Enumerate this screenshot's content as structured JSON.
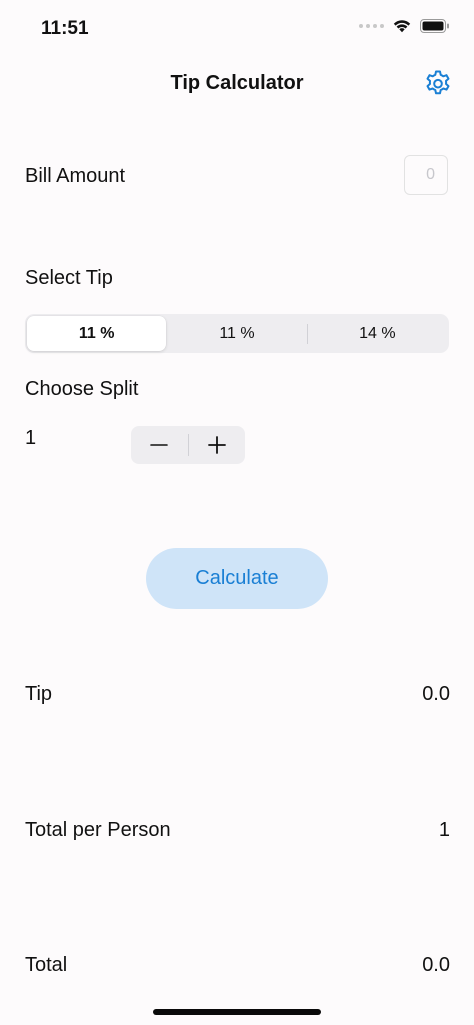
{
  "status_bar": {
    "time": "11:51"
  },
  "nav": {
    "title": "Tip Calculator",
    "settings_icon": "gear-icon"
  },
  "bill": {
    "label": "Bill Amount",
    "input_value": "",
    "placeholder": "0"
  },
  "tip_select": {
    "label": "Select Tip",
    "options": [
      "11 %",
      "11 %",
      "14 %"
    ],
    "selected_index": 0
  },
  "split": {
    "label": "Choose Split",
    "value": "1",
    "decrement_label": "−",
    "increment_label": "+"
  },
  "calculate_button": {
    "label": "Calculate"
  },
  "results": {
    "tip_label": "Tip",
    "tip_value": "0.0",
    "per_person_label": "Total per Person",
    "per_person_value": "1",
    "total_label": "Total",
    "total_value": "0.0"
  },
  "colors": {
    "accent": "#1a7fd4",
    "button_bg": "#cfe4f8",
    "background": "#fdfbfc",
    "control_bg": "#eeedf0"
  }
}
